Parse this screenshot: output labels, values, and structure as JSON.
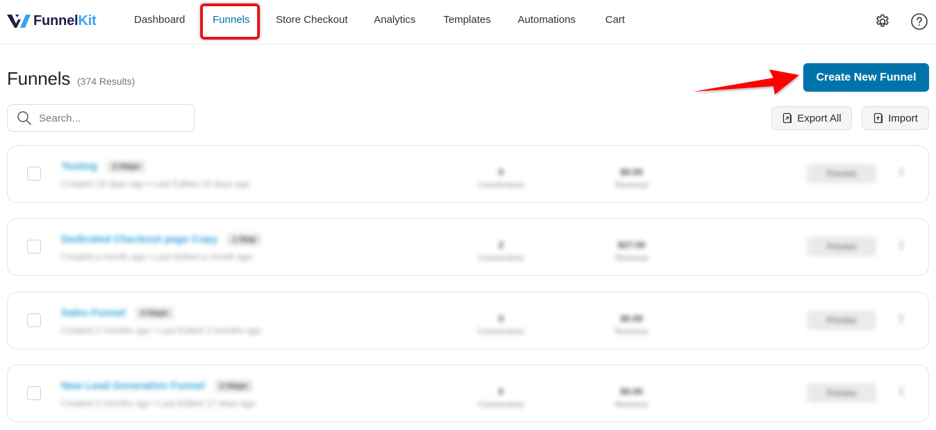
{
  "app": {
    "brand_name_a": "Funnel",
    "brand_name_b": "Kit"
  },
  "nav": {
    "items": [
      {
        "label": "Dashboard",
        "active": false
      },
      {
        "label": "Funnels",
        "active": true
      },
      {
        "label": "Store Checkout",
        "active": false
      },
      {
        "label": "Analytics",
        "active": false
      },
      {
        "label": "Templates",
        "active": false
      },
      {
        "label": "Automations",
        "active": false
      },
      {
        "label": "Cart",
        "active": false
      }
    ],
    "icons": [
      "gear-icon",
      "help-circle-icon"
    ]
  },
  "header": {
    "title": "Funnels",
    "result_count": "(374 Results)",
    "create_button": "Create New Funnel"
  },
  "toolbar": {
    "search_placeholder": "Search...",
    "search_value": "",
    "export_label": "Export All",
    "import_label": "Import"
  },
  "funnels": [
    {
      "name": "Testing",
      "steps": "2 Steps",
      "meta": "Created 19 days ago  •  Last Edited 19 days ago",
      "conversions": "0",
      "conversions_label": "Conversions",
      "revenue": "$0.00",
      "revenue_label": "Revenue",
      "preview_label": "Preview"
    },
    {
      "name": "Dedicated Checkout page Copy",
      "steps": "1 Step",
      "meta": "Created a month ago  •  Last Edited a month ago",
      "conversions": "2",
      "conversions_label": "Conversions",
      "revenue": "$27.00",
      "revenue_label": "Revenue",
      "preview_label": "Preview"
    },
    {
      "name": "Sales Funnel",
      "steps": "4 Steps",
      "meta": "Created 2 months ago  •  Last Edited 2 months ago",
      "conversions": "0",
      "conversions_label": "Conversions",
      "revenue": "$0.00",
      "revenue_label": "Revenue",
      "preview_label": "Preview"
    },
    {
      "name": "New Lead Generation Funnel",
      "steps": "2 Steps",
      "meta": "Created 2 months ago  •  Last Edited 17 days ago",
      "conversions": "0",
      "conversions_label": "Conversions",
      "revenue": "$0.00",
      "revenue_label": "Revenue",
      "preview_label": "Preview"
    }
  ],
  "annotations": {
    "highlight_target": "Funnels",
    "arrow_target": "Create New Funnel",
    "highlight_color": "#e8141b",
    "arrow_color": "#ff0000"
  },
  "colors": {
    "primary": "#0073aa",
    "link": "#2ea3d6",
    "brand_dark": "#1c1f4a",
    "brand_light": "#3aa2ec"
  }
}
